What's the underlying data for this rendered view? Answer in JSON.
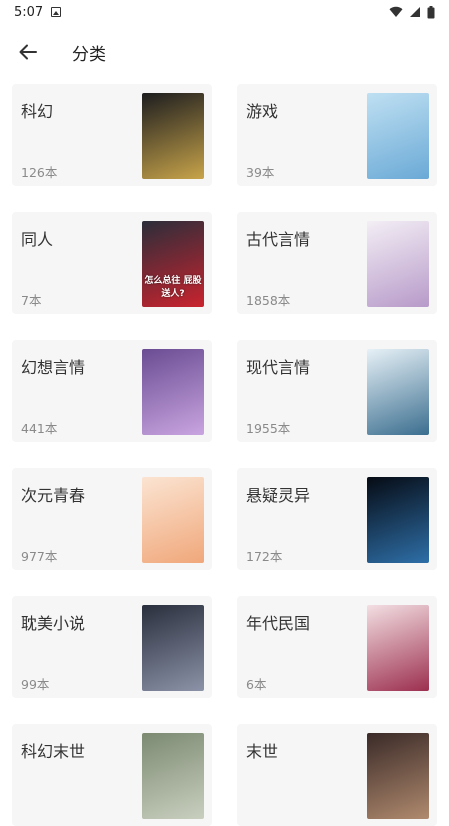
{
  "status_bar": {
    "time": "5:07"
  },
  "header": {
    "title": "分类"
  },
  "categories": [
    {
      "name": "科幻",
      "count": "126本",
      "cover_colors": [
        "#1d1d1f",
        "#c8a44a"
      ],
      "cover_text": ""
    },
    {
      "name": "游戏",
      "count": "39本",
      "cover_colors": [
        "#bfe0f2",
        "#6aa9d6"
      ],
      "cover_text": ""
    },
    {
      "name": "同人",
      "count": "7本",
      "cover_colors": [
        "#2b2e3a",
        "#c9232e"
      ],
      "cover_text": "怎么总往 屁股送人?"
    },
    {
      "name": "古代言情",
      "count": "1858本",
      "cover_colors": [
        "#f3eef5",
        "#b79ac9"
      ],
      "cover_text": ""
    },
    {
      "name": "幻想言情",
      "count": "441本",
      "cover_colors": [
        "#6a4c93",
        "#c9a5e0"
      ],
      "cover_text": ""
    },
    {
      "name": "现代言情",
      "count": "1955本",
      "cover_colors": [
        "#e7f1f7",
        "#3b6e8f"
      ],
      "cover_text": ""
    },
    {
      "name": "次元青春",
      "count": "977本",
      "cover_colors": [
        "#fbe4d2",
        "#f0a77a"
      ],
      "cover_text": ""
    },
    {
      "name": "悬疑灵异",
      "count": "172本",
      "cover_colors": [
        "#060b14",
        "#2e6fa8"
      ],
      "cover_text": ""
    },
    {
      "name": "耽美小说",
      "count": "99本",
      "cover_colors": [
        "#2a2f3d",
        "#8c93a8"
      ],
      "cover_text": ""
    },
    {
      "name": "年代民国",
      "count": "6本",
      "cover_colors": [
        "#f3dfe3",
        "#9c2f4f"
      ],
      "cover_text": ""
    },
    {
      "name": "科幻末世",
      "count": "",
      "cover_colors": [
        "#7c8a72",
        "#c9cfbf"
      ],
      "cover_text": ""
    },
    {
      "name": "末世",
      "count": "",
      "cover_colors": [
        "#3a2a28",
        "#b08a6e"
      ],
      "cover_text": ""
    }
  ]
}
